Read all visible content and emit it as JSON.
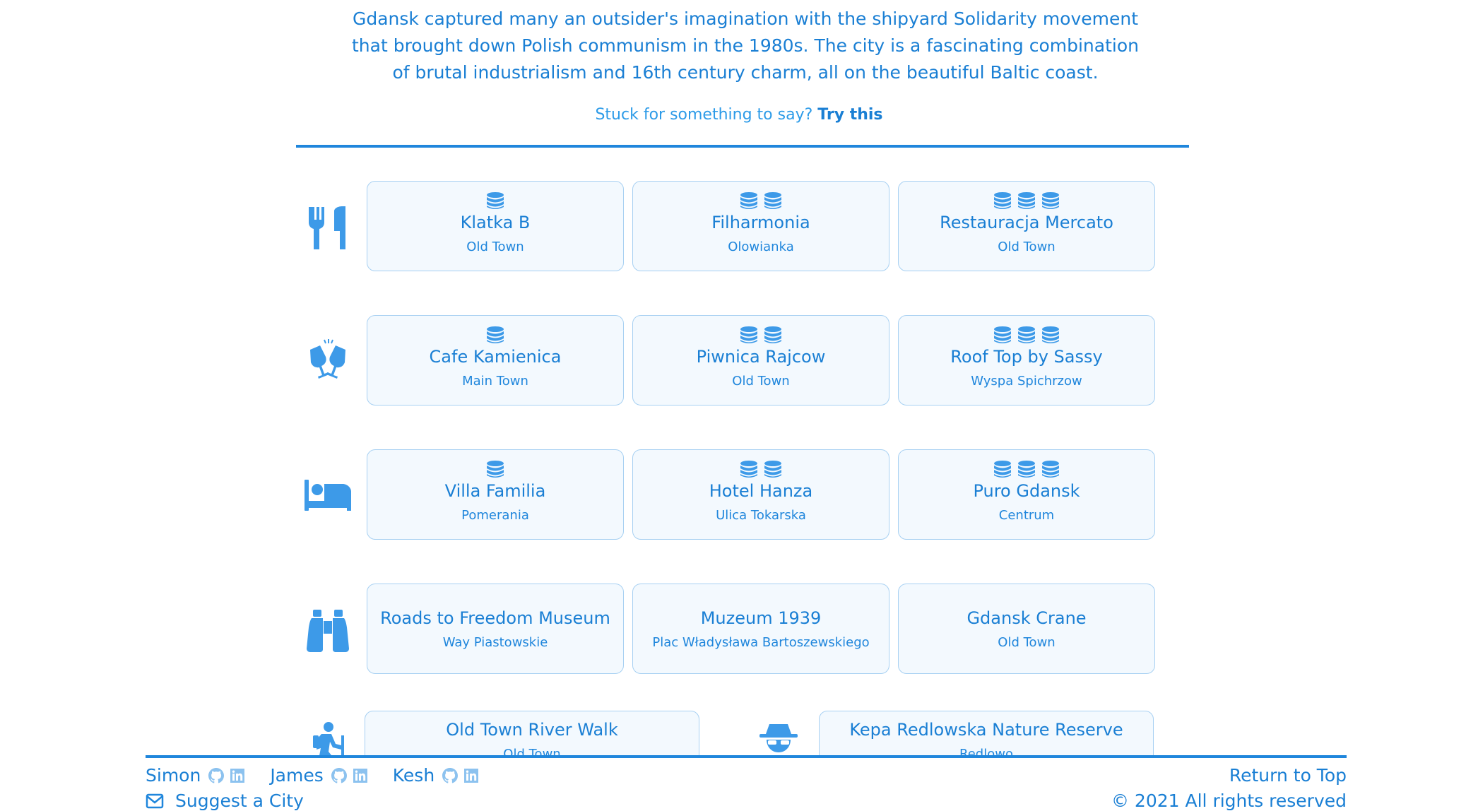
{
  "intro": {
    "line1": "Gdansk captured many an outsider's imagination with the shipyard Solidarity movement",
    "line2": "that brought down Polish communism in the 1980s. The city is a fascinating combination",
    "line3": "of brutal industrialism and 16th century charm, all on the beautiful Baltic coast."
  },
  "stuck": {
    "text": "Stuck for something to say?",
    "link": "Try this"
  },
  "rows": [
    {
      "icon": "utensils-icon",
      "cards": [
        {
          "coins": 1,
          "name": "Klatka B",
          "area": "Old Town"
        },
        {
          "coins": 2,
          "name": "Filharmonia",
          "area": "Olowianka"
        },
        {
          "coins": 3,
          "name": "Restauracja Mercato",
          "area": "Old Town"
        }
      ]
    },
    {
      "icon": "glasses-cheers-icon",
      "cards": [
        {
          "coins": 1,
          "name": "Cafe Kamienica",
          "area": "Main Town"
        },
        {
          "coins": 2,
          "name": "Piwnica Rajcow",
          "area": "Old Town"
        },
        {
          "coins": 3,
          "name": "Roof Top by Sassy",
          "area": "Wyspa Spichrzow"
        }
      ]
    },
    {
      "icon": "bed-icon",
      "cards": [
        {
          "coins": 1,
          "name": "Villa Familia",
          "area": "Pomerania"
        },
        {
          "coins": 2,
          "name": "Hotel Hanza",
          "area": "Ulica Tokarska"
        },
        {
          "coins": 3,
          "name": "Puro Gdansk",
          "area": "Centrum"
        }
      ]
    },
    {
      "icon": "binoculars-icon",
      "cards": [
        {
          "coins": 0,
          "name": "Roads to Freedom Museum",
          "area": "Way Piastowskie"
        },
        {
          "coins": 0,
          "name": "Muzeum 1939",
          "area": "Plac Władysława Bartoszewskiego"
        },
        {
          "coins": 0,
          "name": "Gdansk Crane",
          "area": "Old Town"
        }
      ]
    }
  ],
  "bottom": {
    "left": {
      "icon": "hiking-icon",
      "name": "Old Town River Walk",
      "area": "Old Town"
    },
    "right": {
      "icon": "user-secret-icon",
      "name": "Kepa Redlowska Nature Reserve",
      "area": "Redlowo"
    }
  },
  "footer": {
    "devs": [
      "Simon",
      "James",
      "Kesh"
    ],
    "suggest": "Suggest a City",
    "return": "Return to Top",
    "copyright": "© 2021 All rights reserved"
  },
  "colors": {
    "accent": "#1a7fd4",
    "card_bg": "#f3f9fe",
    "card_border": "#a7d0f2",
    "icon": "#3d9ae8"
  }
}
